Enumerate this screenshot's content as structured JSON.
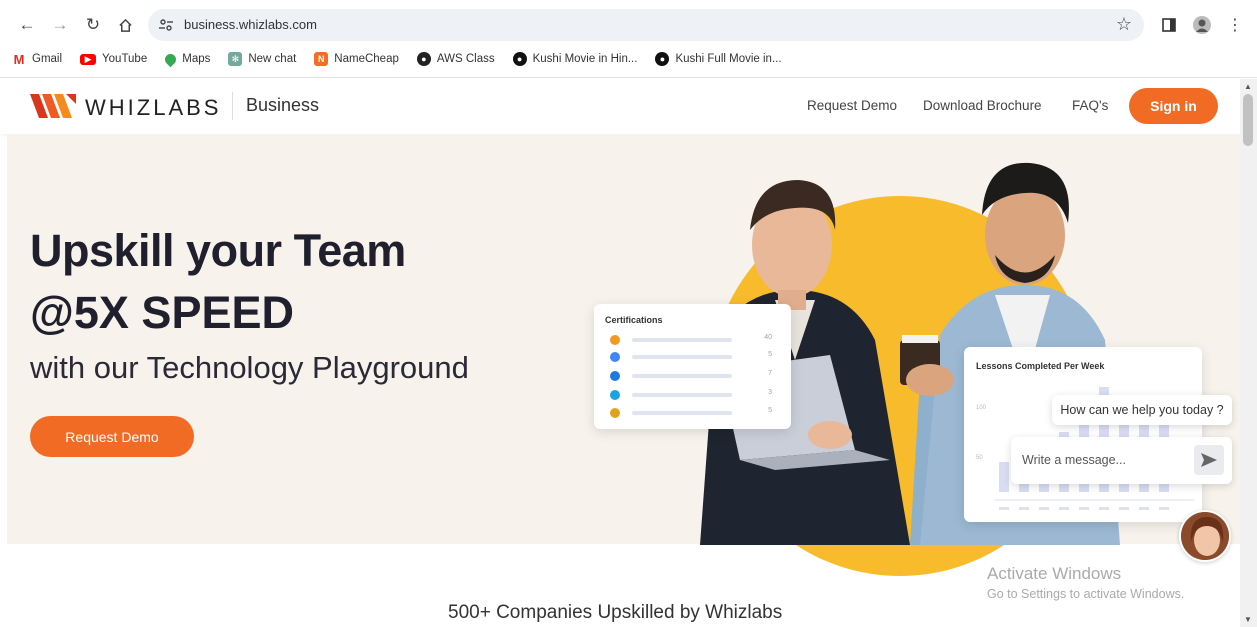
{
  "browser": {
    "url": "business.whizlabs.com",
    "bookmarks": [
      "Gmail",
      "YouTube",
      "Maps",
      "New chat",
      "NameCheap",
      "AWS Class",
      "Kushi Movie in Hin...",
      "Kushi Full Movie in..."
    ]
  },
  "header": {
    "logo_text": "WHIZLABS",
    "logo_sub": "Business",
    "nav": [
      "Request Demo",
      "Download Brochure",
      "FAQ's"
    ],
    "signin": "Sign in"
  },
  "hero": {
    "line1": "Upskill your Team",
    "line2": "@5X SPEED",
    "line3": "with our Technology Playground",
    "cta": "Request Demo",
    "cert_card": {
      "title": "Certifications",
      "rows": [
        {
          "icon": "aws-icon",
          "value": "40",
          "color": "#f29a1f"
        },
        {
          "icon": "gcp-icon",
          "value": "5",
          "color": "#4285f4"
        },
        {
          "icon": "azure-icon",
          "value": "7",
          "color": "#1f7ae0"
        },
        {
          "icon": "salesforce-icon",
          "value": "3",
          "color": "#19a3e0"
        },
        {
          "icon": "linux-icon",
          "value": "5",
          "color": "#e0a31f"
        }
      ]
    },
    "lesson_card": {
      "title": "Lessons Completed Per Week",
      "ticks": [
        "100",
        "50"
      ]
    }
  },
  "chat": {
    "question": "How can we help you today ?",
    "placeholder": "Write a message..."
  },
  "watermark": {
    "line1": "Activate Windows",
    "line2": "Go to Settings to activate Windows."
  },
  "companies_heading": "500+ Companies Upskilled by Whizlabs",
  "colors": {
    "accent": "#f26b24",
    "hero_bg": "#f7f2ec",
    "circle": "#f7bb2b"
  }
}
